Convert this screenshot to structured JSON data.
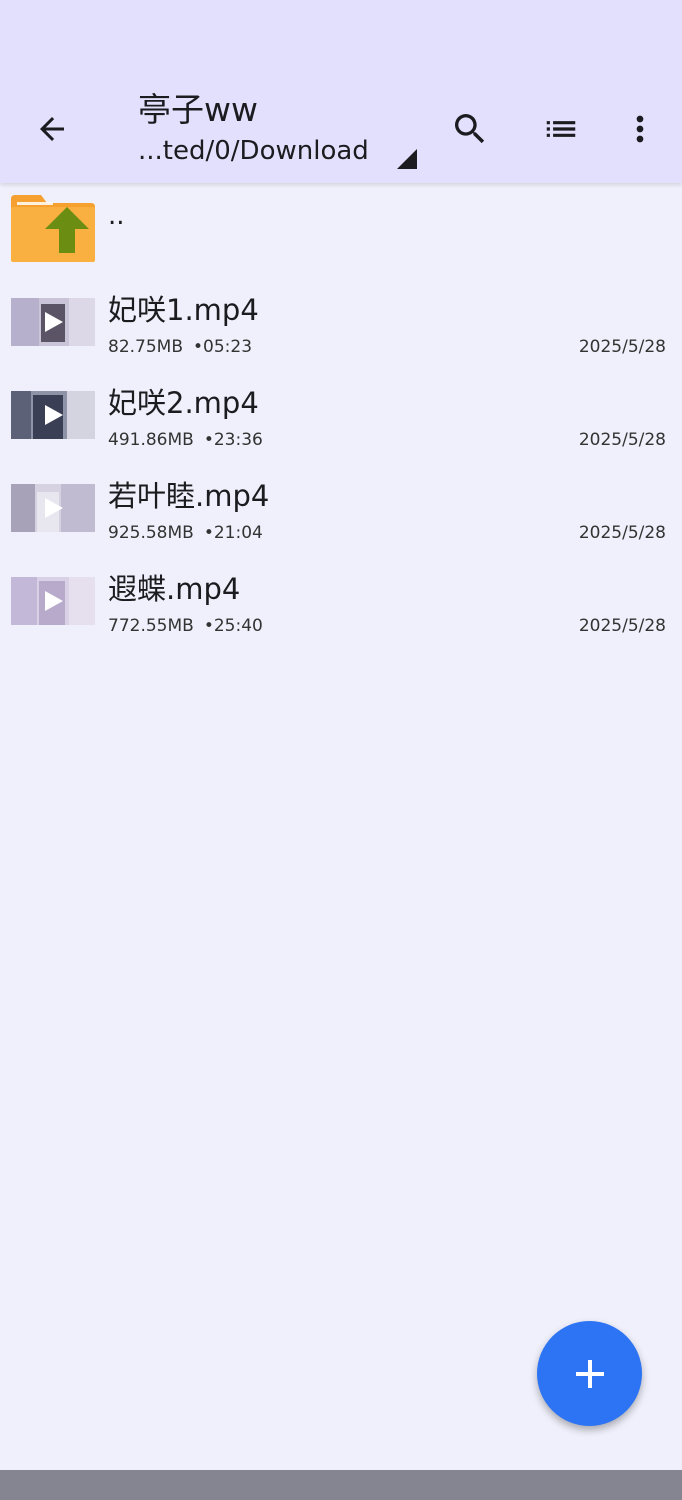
{
  "appbar": {
    "title": "亭子ww",
    "path": "...ted/0/Download",
    "icons": {
      "back": "arrow-left-icon",
      "search": "search-icon",
      "view": "list-view-icon",
      "more": "more-vert-icon"
    }
  },
  "parent": {
    "label": ".."
  },
  "files": [
    {
      "name": "妃咲1.mp4",
      "size": "82.75MB",
      "duration": "•05:23",
      "date": "2025/5/28"
    },
    {
      "name": "妃咲2.mp4",
      "size": "491.86MB",
      "duration": "•23:36",
      "date": "2025/5/28"
    },
    {
      "name": "若叶睦.mp4",
      "size": "925.58MB",
      "duration": "•21:04",
      "date": "2025/5/28"
    },
    {
      "name": "遐蝶.mp4",
      "size": "772.55MB",
      "duration": "•25:40",
      "date": "2025/5/28"
    }
  ],
  "fab": {
    "icon": "plus-icon"
  },
  "colors": {
    "appbar": "#e3e0fd",
    "background": "#eff0fb",
    "fab": "#2c74f4",
    "folder": "#f6a030",
    "folder_arrow": "#6b8e12"
  }
}
